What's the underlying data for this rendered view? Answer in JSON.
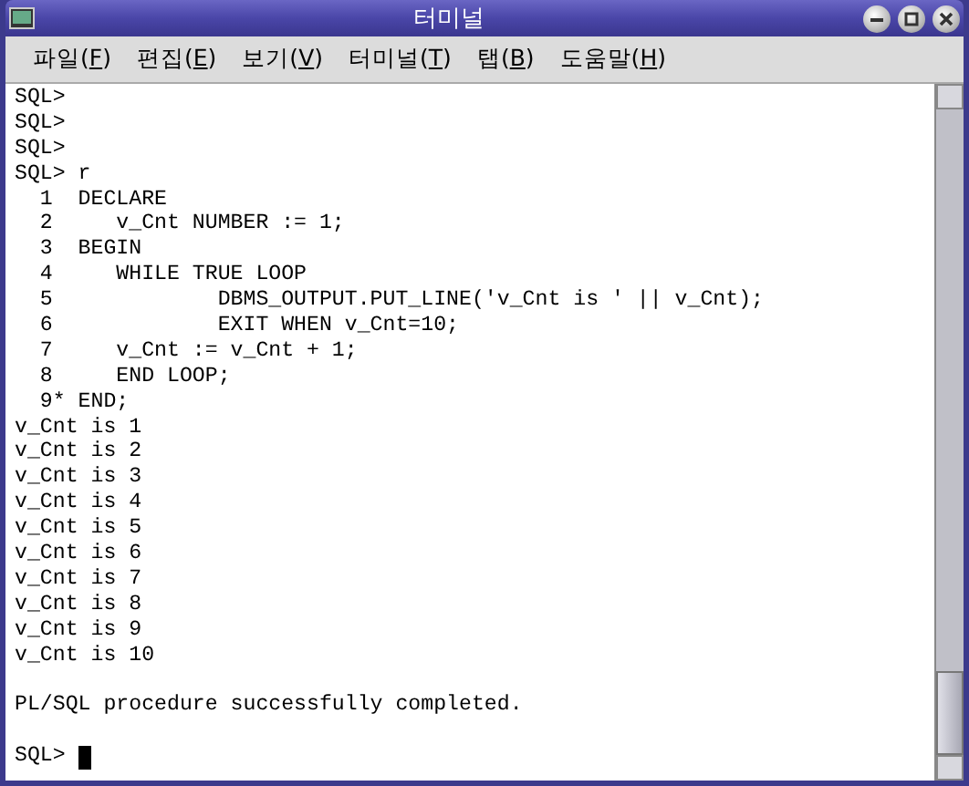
{
  "window": {
    "title": "터미널"
  },
  "menu": [
    {
      "before": "파일(",
      "key": "F",
      "after": ")"
    },
    {
      "before": "편집(",
      "key": "E",
      "after": ")"
    },
    {
      "before": "보기(",
      "key": "V",
      "after": ")"
    },
    {
      "before": "터미널(",
      "key": "T",
      "after": ")"
    },
    {
      "before": "탭(",
      "key": "B",
      "after": ")"
    },
    {
      "before": "도움말(",
      "key": "H",
      "after": ")"
    }
  ],
  "terminal": {
    "lines": [
      {
        "kind": "text",
        "text": "SQL>"
      },
      {
        "kind": "text",
        "text": "SQL>"
      },
      {
        "kind": "text",
        "text": "SQL>"
      },
      {
        "kind": "text",
        "text": "SQL> r"
      },
      {
        "kind": "text",
        "text": "  1  DECLARE"
      },
      {
        "kind": "text",
        "text": "  2     v_Cnt NUMBER := 1;"
      },
      {
        "kind": "text",
        "text": "  3  BEGIN"
      },
      {
        "kind": "text",
        "text": "  4     WHILE TRUE LOOP"
      },
      {
        "kind": "text",
        "text": "  5             DBMS_OUTPUT.PUT_LINE('v_Cnt is ' || v_Cnt);"
      },
      {
        "kind": "text",
        "text": "  6             EXIT WHEN v_Cnt=10;"
      },
      {
        "kind": "text",
        "text": "  7     v_Cnt := v_Cnt + 1;"
      },
      {
        "kind": "text",
        "text": "  8     END LOOP;"
      },
      {
        "kind": "text",
        "text": "  9* END;"
      },
      {
        "kind": "text",
        "text": "v_Cnt is 1"
      },
      {
        "kind": "text",
        "text": "v_Cnt is 2"
      },
      {
        "kind": "text",
        "text": "v_Cnt is 3"
      },
      {
        "kind": "text",
        "text": "v_Cnt is 4"
      },
      {
        "kind": "text",
        "text": "v_Cnt is 5"
      },
      {
        "kind": "text",
        "text": "v_Cnt is 6"
      },
      {
        "kind": "text",
        "text": "v_Cnt is 7"
      },
      {
        "kind": "text",
        "text": "v_Cnt is 8"
      },
      {
        "kind": "text",
        "text": "v_Cnt is 9"
      },
      {
        "kind": "text",
        "text": "v_Cnt is 10"
      },
      {
        "kind": "blank"
      },
      {
        "kind": "text",
        "text": "PL/SQL procedure successfully completed."
      },
      {
        "kind": "blank"
      },
      {
        "kind": "cursor",
        "text": "SQL>"
      }
    ]
  }
}
